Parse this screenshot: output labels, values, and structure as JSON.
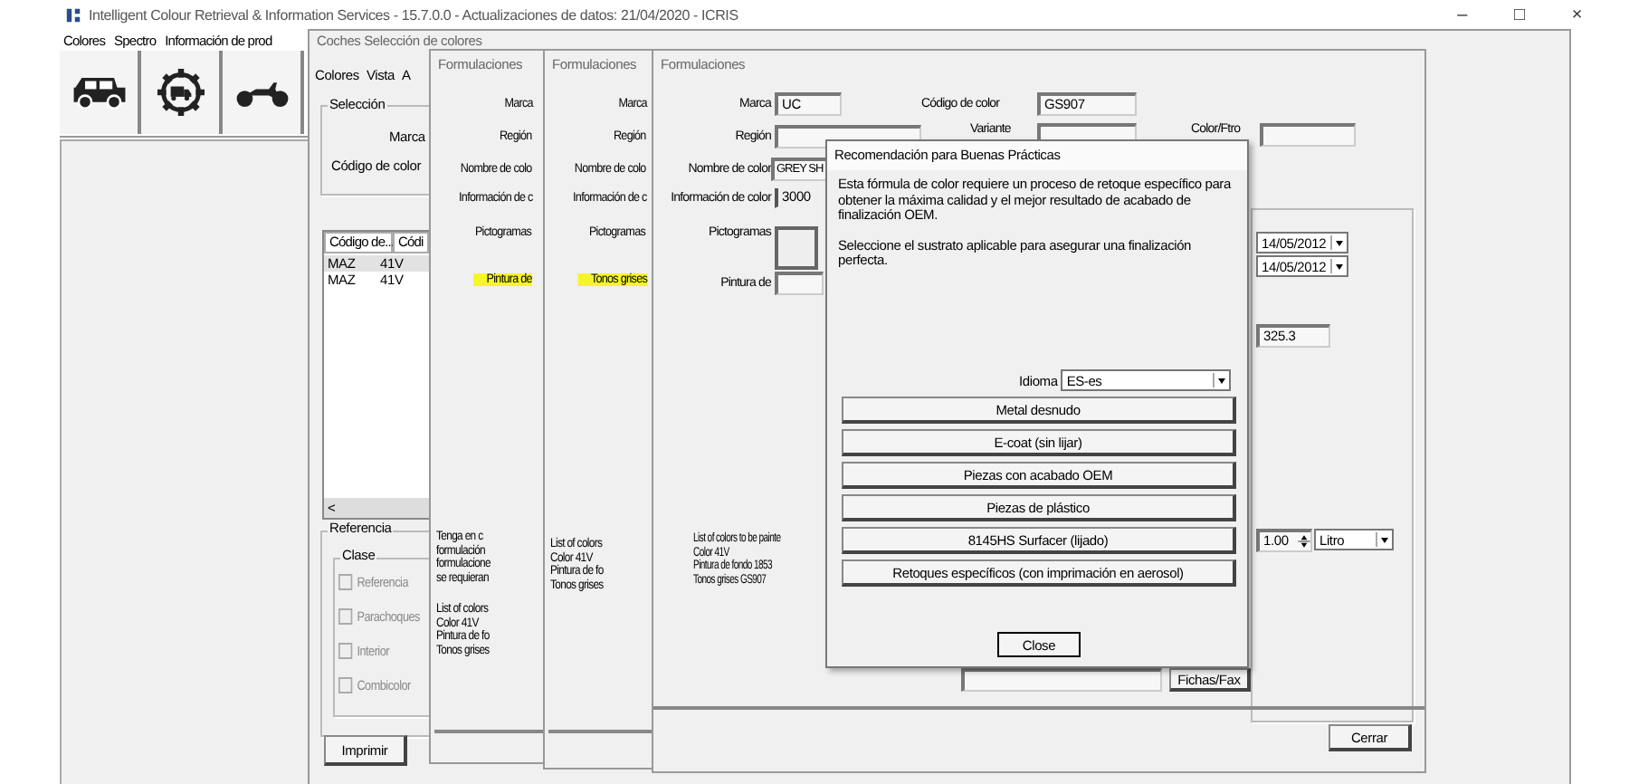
{
  "app": {
    "title": "Intelligent Colour Retrieval & Information Services - 15.7.0.0 - Actualizaciones de datos: 21/04/2020 - ICRIS",
    "controls": [
      "–",
      "□",
      "×"
    ],
    "menu": [
      "Colores",
      "Spectro",
      "Información de prod"
    ]
  },
  "coches": {
    "title": "Coches Selección de colores",
    "menu": [
      "Colores",
      "Vista",
      "A"
    ],
    "seleccion": {
      "title": "Selección",
      "labels": [
        "Marca",
        "Código de color"
      ]
    },
    "list": {
      "columns": [
        "Código de...",
        "Códi"
      ],
      "rows": [
        {
          "cells": [
            "MAZ",
            "41V"
          ],
          "selected": true
        },
        {
          "cells": [
            "MAZ",
            "41V"
          ],
          "selected": false
        }
      ],
      "scroll_arrow": "<"
    },
    "referencia": {
      "title": "Referencia",
      "clase": "Clase",
      "options": [
        {
          "label": "Referencia",
          "checked": false,
          "disabled": true
        },
        {
          "label": "Parachoques",
          "checked": false,
          "disabled": true
        },
        {
          "label": "Interior",
          "checked": false,
          "disabled": true
        },
        {
          "label": "Combicolor",
          "checked": false,
          "disabled": true
        }
      ]
    },
    "print_button": "Imprimir"
  },
  "formulaciones": [
    {
      "title": "Formulaciones",
      "labels": [
        "Marca",
        "Región",
        "Nombre de colo",
        "Información de c",
        "Pictogramas"
      ],
      "highlight": "Pintura de",
      "notes": [
        "Tenga en c",
        "formulación",
        "formulacione",
        "se requieran"
      ],
      "colors": [
        "List of colors",
        "Color 41V",
        "Pintura de fo",
        "Tonos grises"
      ]
    },
    {
      "title": "Formulaciones",
      "labels": [
        "Marca",
        "Región",
        "Nombre de colo",
        "Información de c",
        "Pictogramas"
      ],
      "highlight": "Tonos grises",
      "colors": [
        "List of colors",
        "Color 41V",
        "Pintura de fo",
        "Tonos grises"
      ]
    }
  ],
  "formulacion": {
    "title": "Formulaciones",
    "marca": {
      "label": "Marca",
      "value": "UC"
    },
    "region": {
      "label": "Región"
    },
    "nombre": {
      "label": "Nombre de color",
      "value": "GREY SH"
    },
    "informacion": {
      "label": "Información de color",
      "value": "3000"
    },
    "pictogramas": {
      "label": "Pictogramas"
    },
    "pintura": {
      "label": "Pintura de"
    },
    "codigo": {
      "label": "Código de color",
      "value": "GS907"
    },
    "variante": {
      "label": "Variante"
    },
    "color_filtro": {
      "label": "Color/Ftro"
    },
    "colors": [
      "List of colors to be painte",
      "Color 41V",
      "Pintura de fondo 1853",
      "Tonos grises GS907"
    ],
    "dates": [
      "14/05/2012",
      "14/05/2012"
    ],
    "amount": "325.3",
    "quantity": "1.00",
    "unit": "Litro",
    "fichas_button": "Fichas/Fax",
    "close_button": "Cerrar"
  },
  "dialog": {
    "title": "Recomendación para Buenas Prácticas",
    "paragraphs": [
      "Esta fórmula de color requiere un proceso de retoque específico para obtener la máxima calidad y el mejor resultado de acabado de finalización OEM.",
      "Seleccione el sustrato aplicable para asegurar una finalización perfecta."
    ],
    "language": {
      "label": "Idioma",
      "value": "ES-es"
    },
    "options": [
      "Metal desnudo",
      "E-coat (sin lijar)",
      "Piezas con acabado OEM",
      "Piezas de plástico",
      "8145HS Surfacer (lijado)",
      "Retoques específicos (con imprimación en aerosol)"
    ],
    "close": "Close"
  }
}
